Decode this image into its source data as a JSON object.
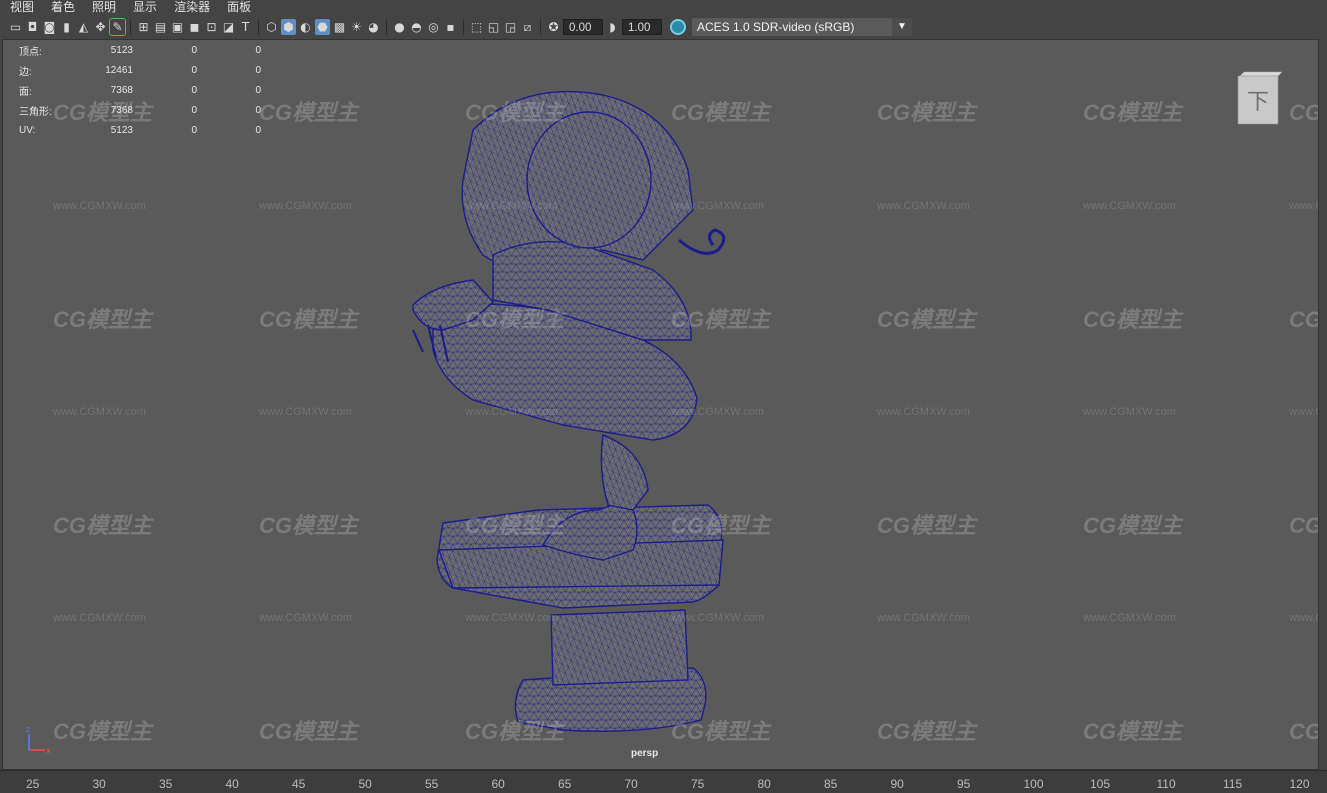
{
  "menu": [
    "视图",
    "着色",
    "照明",
    "显示",
    "渲染器",
    "面板"
  ],
  "toolbar": {
    "exposure_value": "0.00",
    "gamma_value": "1.00",
    "color_space": "ACES 1.0 SDR-video (sRGB)"
  },
  "hud": {
    "rows": [
      {
        "label": "顶点:",
        "value": "5123",
        "a": "0",
        "b": "0"
      },
      {
        "label": "边:",
        "value": "12461",
        "a": "0",
        "b": "0"
      },
      {
        "label": "面:",
        "value": "7368",
        "a": "0",
        "b": "0"
      },
      {
        "label": "三角形:",
        "value": "7368",
        "a": "0",
        "b": "0"
      },
      {
        "label": "UV:",
        "value": "5123",
        "a": "0",
        "b": "0"
      }
    ]
  },
  "viewcube_label": "下",
  "camera_label": "persp",
  "watermark": {
    "logo": "CG模型主",
    "url": "www.CGMXW.com"
  },
  "timeline_ticks": [
    "25",
    "30",
    "35",
    "40",
    "45",
    "50",
    "55",
    "60",
    "65",
    "70",
    "75",
    "80",
    "85",
    "90",
    "95",
    "100",
    "105",
    "110",
    "115",
    "120"
  ],
  "colors": {
    "wire": "#1c1c8c",
    "accent": "#5d8fc4",
    "viewport": "#5a5a5a"
  }
}
